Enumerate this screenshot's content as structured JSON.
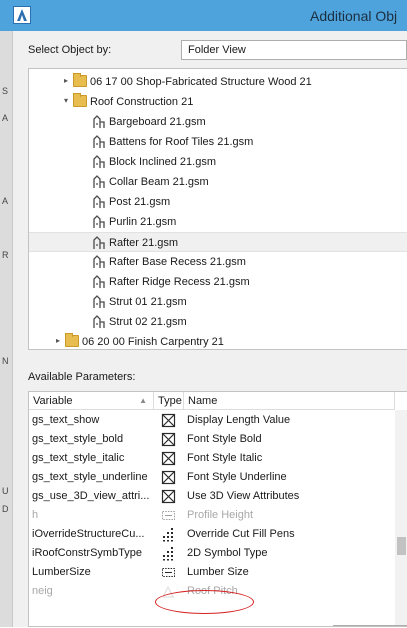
{
  "window": {
    "title": "Additional Obj",
    "accent": "#4ea3dc"
  },
  "left_strip_marks": [
    "S",
    "A",
    "A",
    "R",
    "N",
    "U",
    "D"
  ],
  "selector": {
    "label": "Select Object by:",
    "value": "Folder View"
  },
  "tree": {
    "rows": [
      {
        "label": "06 17 00 Shop-Fabricated Structure Wood 21",
        "kind": "folder",
        "twisty": "▸",
        "indent": 1,
        "selected": false
      },
      {
        "label": "Roof Construction 21",
        "kind": "folder",
        "twisty": "▾",
        "indent": 1,
        "selected": false
      },
      {
        "label": "Bargeboard 21.gsm",
        "kind": "gsm",
        "twisty": "",
        "indent": 2,
        "selected": false
      },
      {
        "label": "Battens for Roof Tiles 21.gsm",
        "kind": "gsm",
        "twisty": "",
        "indent": 2,
        "selected": false
      },
      {
        "label": "Block Inclined 21.gsm",
        "kind": "gsm",
        "twisty": "",
        "indent": 2,
        "selected": false
      },
      {
        "label": "Collar Beam 21.gsm",
        "kind": "gsm",
        "twisty": "",
        "indent": 2,
        "selected": false
      },
      {
        "label": "Post 21.gsm",
        "kind": "gsm",
        "twisty": "",
        "indent": 2,
        "selected": false
      },
      {
        "label": "Purlin 21.gsm",
        "kind": "gsm",
        "twisty": "",
        "indent": 2,
        "selected": false
      },
      {
        "label": "Rafter 21.gsm",
        "kind": "gsm",
        "twisty": "",
        "indent": 2,
        "selected": true
      },
      {
        "label": "Rafter Base Recess 21.gsm",
        "kind": "gsm",
        "twisty": "",
        "indent": 2,
        "selected": false
      },
      {
        "label": "Rafter Ridge Recess 21.gsm",
        "kind": "gsm",
        "twisty": "",
        "indent": 2,
        "selected": false
      },
      {
        "label": "Strut 01 21.gsm",
        "kind": "gsm",
        "twisty": "",
        "indent": 2,
        "selected": false
      },
      {
        "label": "Strut 02 21.gsm",
        "kind": "gsm",
        "twisty": "",
        "indent": 2,
        "selected": false
      },
      {
        "label": "06 20 00 Finish Carpentry 21",
        "kind": "folder",
        "twisty": "▸",
        "indent": 0,
        "selected": false
      }
    ]
  },
  "parameters": {
    "label": "Available Parameters:",
    "columns": {
      "variable": "Variable",
      "type": "Type",
      "name": "Name"
    },
    "rows": [
      {
        "variable": "gs_text_show",
        "type_icon": "checkbox-cross-icon",
        "name": "Display Length Value",
        "disabled": false
      },
      {
        "variable": "gs_text_style_bold",
        "type_icon": "checkbox-cross-icon",
        "name": "Font Style Bold",
        "disabled": false
      },
      {
        "variable": "gs_text_style_italic",
        "type_icon": "checkbox-cross-icon",
        "name": "Font Style Italic",
        "disabled": false
      },
      {
        "variable": "gs_text_style_underline",
        "type_icon": "checkbox-cross-icon",
        "name": "Font Style Underline",
        "disabled": false
      },
      {
        "variable": "gs_use_3D_view_attri...",
        "type_icon": "checkbox-cross-icon",
        "name": "Use 3D View Attributes",
        "disabled": false
      },
      {
        "variable": "h",
        "type_icon": "length-dashed-icon",
        "name": "Profile Height",
        "disabled": true
      },
      {
        "variable": "iOverrideStructureCu...",
        "type_icon": "fill-pattern-icon",
        "name": "Override Cut Fill Pens",
        "disabled": false
      },
      {
        "variable": "iRoofConstrSymbType",
        "type_icon": "fill-pattern-icon",
        "name": "2D Symbol Type",
        "disabled": false
      },
      {
        "variable": "LumberSize",
        "type_icon": "length-dashed-icon",
        "name": "Lumber Size",
        "disabled": false
      },
      {
        "variable": "neig",
        "type_icon": "angle-icon",
        "name": "Roof Pitch",
        "disabled": true
      }
    ]
  }
}
